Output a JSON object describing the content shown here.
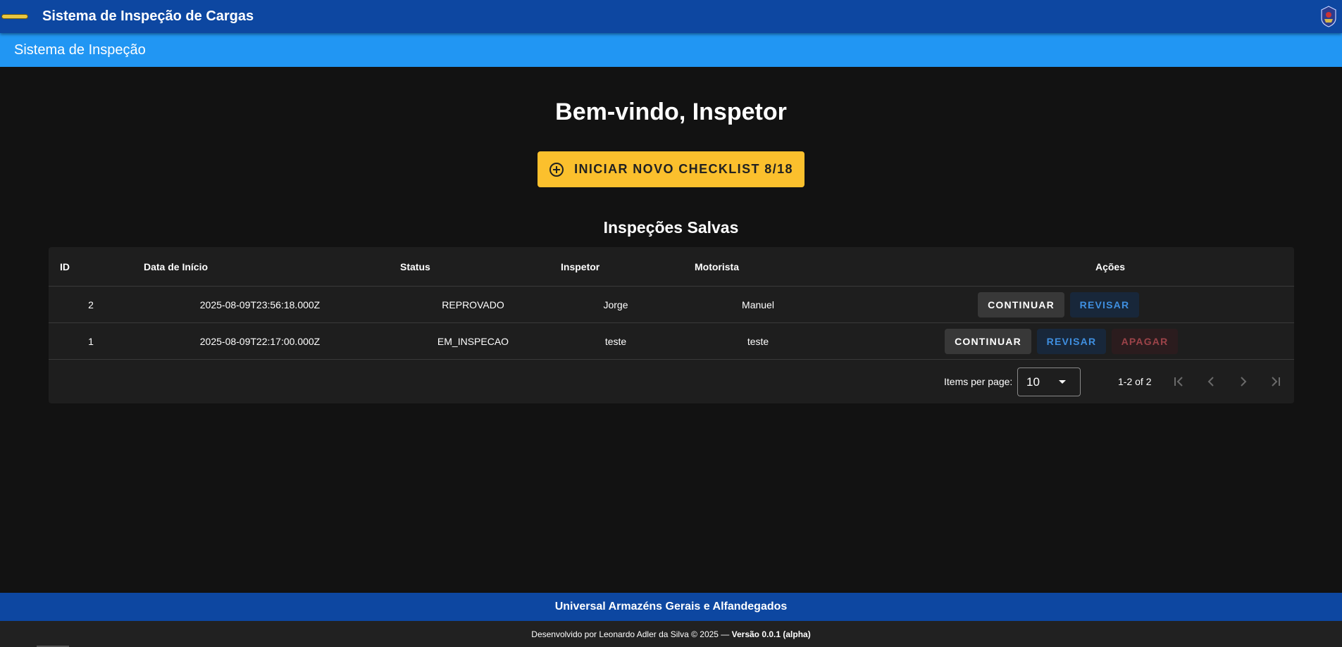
{
  "header": {
    "app_title": "Sistema de Inspeção de Cargas",
    "left_logo_icon": "company-badge-icon",
    "right_logo_icon": "crest-emblem-icon"
  },
  "subheader": {
    "title": "Sistema de Inspeção"
  },
  "main": {
    "welcome": "Bem-vindo, Inspetor",
    "new_checklist_button": "INICIAR NOVO CHECKLIST 8/18",
    "new_checklist_icon": "add-circle-icon",
    "saved_title": "Inspeções Salvas"
  },
  "table": {
    "headers": {
      "id": "ID",
      "start": "Data de Início",
      "status": "Status",
      "inspector": "Inspetor",
      "driver": "Motorista",
      "actions": "Ações"
    },
    "rows": [
      {
        "id": "2",
        "start": "2025-08-09T23:56:18.000Z",
        "status": "REPROVADO",
        "inspector": "Jorge",
        "driver": "Manuel",
        "continue": "CONTINUAR",
        "review": "REVISAR"
      },
      {
        "id": "1",
        "start": "2025-08-09T22:17:00.000Z",
        "status": "EM_INSPECAO",
        "inspector": "teste",
        "driver": "teste",
        "continue": "CONTINUAR",
        "review": "REVISAR",
        "delete": "APAGAR"
      }
    ]
  },
  "pagination": {
    "items_per_page_label": "Items per page:",
    "items_per_page_value": "10",
    "range": "1-2 of 2"
  },
  "footer": {
    "company": "Universal Armazéns Gerais e Alfandegados",
    "credit": "Desenvolvido por Leonardo Adler da Silva © 2025 —",
    "version": "Versão 0.0.1 (alpha)"
  },
  "colors": {
    "header_blue": "#0d47a1",
    "subheader_blue": "#2196f3",
    "background": "#121212",
    "card": "#1e1e1e",
    "accent_yellow": "#fbc02d",
    "review_blue": "#3f8fe0",
    "delete_red": "#9c4349"
  }
}
